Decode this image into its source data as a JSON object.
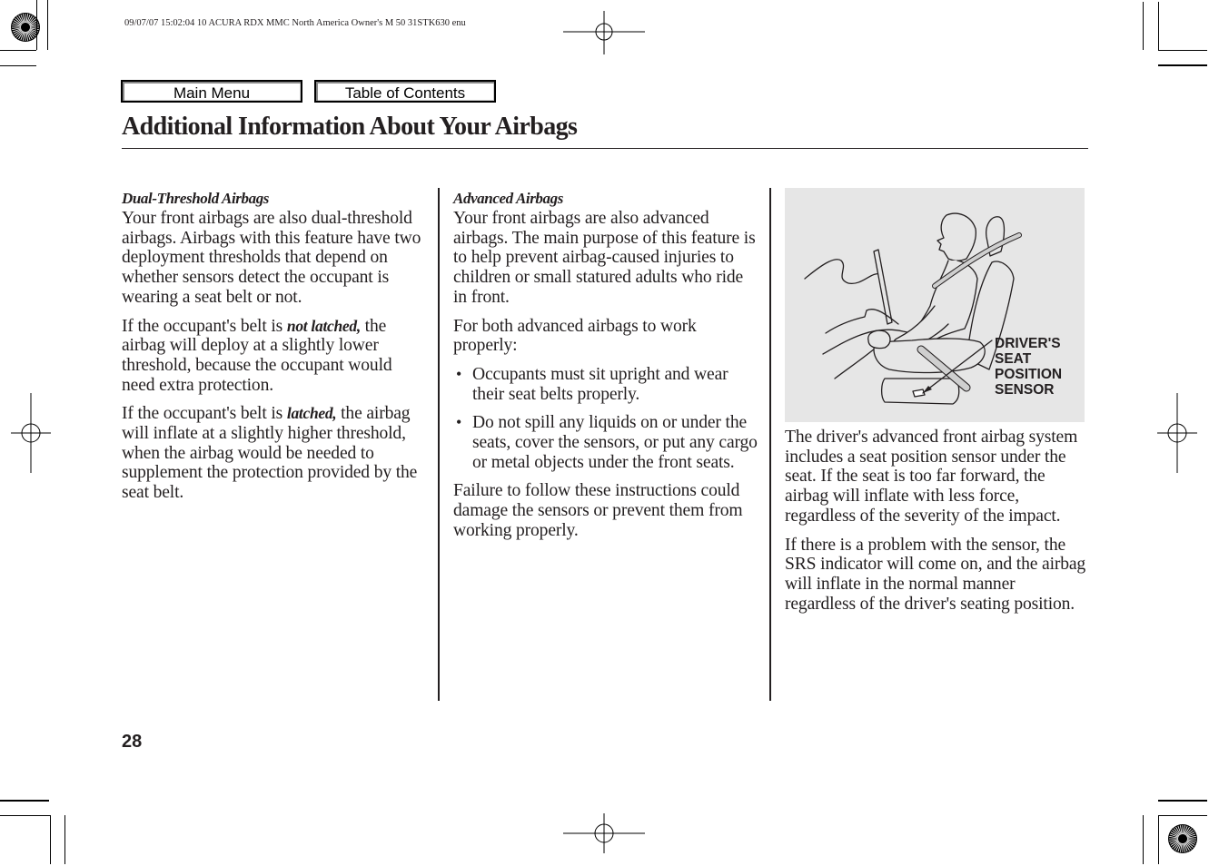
{
  "print_meta": {
    "text": "09/07/07 15:02:04    10 ACURA RDX MMC North America Owner's M 50 31STK630 enu"
  },
  "nav": {
    "main_menu_label": "Main Menu",
    "toc_label": "Table of Contents"
  },
  "page": {
    "title": "Additional Information About Your Airbags",
    "page_number": "28"
  },
  "columns": {
    "left": {
      "heading": "Dual-Threshold Airbags",
      "p1": "Your front airbags are also dual-threshold airbags. Airbags with this feature have two deployment thresholds that depend on whether sensors detect the occupant is wearing a seat belt or not.",
      "p2_pre": "If the occupant's belt is ",
      "p2_emph": "not latched,",
      "p2_post": " the airbag will deploy at a slightly lower threshold, because the occupant would need extra protection.",
      "p3_pre": "If the occupant's belt is ",
      "p3_emph": "latched,",
      "p3_post": " the airbag will inflate at a slightly higher threshold, when the airbag would be needed to supplement the protection provided by the seat belt."
    },
    "middle": {
      "heading": "Advanced Airbags",
      "p1": "Your front airbags are also advanced airbags. The main purpose of this feature is to help prevent airbag-caused injuries to children or small statured adults who ride in front.",
      "p2": "For both advanced airbags to work properly:",
      "bullets": [
        "Occupants must sit upright and wear their seat belts properly.",
        "Do not spill any liquids on or under the seats, cover the sensors, or put any cargo or metal objects under the front seats."
      ],
      "p3": "Failure to follow these instructions could damage the sensors or prevent them from working properly."
    },
    "right": {
      "figure_label_lines": [
        "DRIVER'S",
        "SEAT",
        "POSITION",
        "SENSOR"
      ],
      "p1": "The driver's advanced front airbag system includes a seat position sensor under the seat. If the seat is too far forward, the airbag will inflate with less force, regardless of the severity of the impact.",
      "p2": "If there is a problem with the sensor, the SRS indicator will come on, and the airbag will inflate in the normal manner regardless of the driver's seating position."
    }
  },
  "colors": {
    "text": "#231f20",
    "figure_bg": "#e6e6e6"
  }
}
